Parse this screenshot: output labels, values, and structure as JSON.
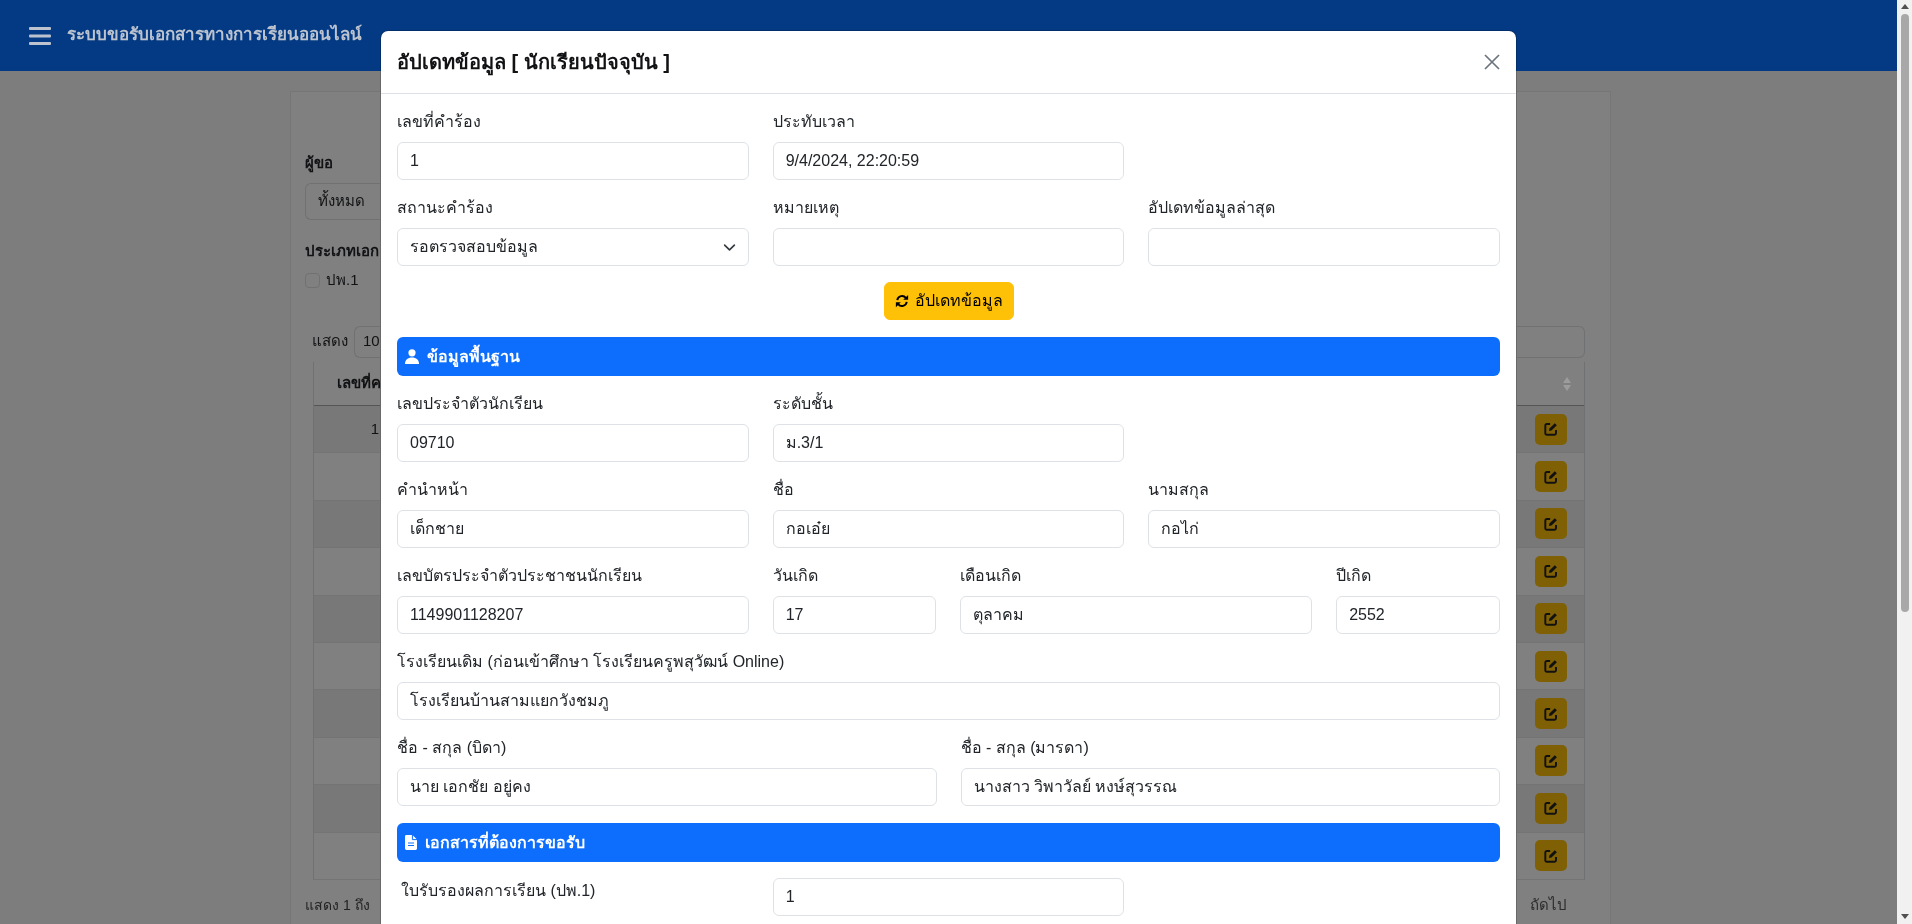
{
  "header": {
    "title": "ระบบขอรับเอกสารทางการเรียนออนไลน์"
  },
  "background": {
    "filter": {
      "requester_label": "ผู้ขอ",
      "requester_value": "ทั้งหมด",
      "doc_type_label": "ประเภทเอก",
      "doc_types": [
        {
          "label": "ปพ.1",
          "checked": false
        }
      ]
    },
    "table": {
      "length_label": "แสดง",
      "length_value": "10",
      "columns": [
        "เลขที่ค"
      ],
      "rows": [
        {
          "kind": "edit",
          "column_1": "1"
        },
        {
          "kind": "edit"
        },
        {
          "kind": "edit"
        },
        {
          "kind": "edit"
        },
        {
          "kind": "edit"
        },
        {
          "kind": "edit"
        },
        {
          "kind": "edit"
        },
        {
          "kind": "edit"
        },
        {
          "kind": "edit"
        },
        {
          "kind": "edit"
        }
      ],
      "info": "แสดง 1 ถึง",
      "next": "ถัดไป"
    }
  },
  "modal": {
    "title": "อัปเดทข้อมูล [ นักเรียนปัจจุบัน ]",
    "request_rows": [
      {
        "fields": [
          {
            "kind": "input",
            "label": "เลขที่คำร้อง",
            "value": "1"
          },
          {
            "kind": "input",
            "label": "ประทับเวลา",
            "value": "9/4/2024, 22:20:59"
          }
        ]
      },
      {
        "fields": [
          {
            "kind": "select",
            "label": "สถานะคำร้อง",
            "value": "รอตรวจสอบข้อมูล"
          },
          {
            "kind": "input",
            "label": "หมายเหตุ"
          },
          {
            "kind": "input",
            "label": "อัปเดทข้อมูลล่าสุด"
          }
        ]
      }
    ],
    "update_button": "อัปเดทข้อมูล",
    "sections": [
      {
        "kind": "person",
        "title": "ข้อมูลพื้นฐาน",
        "rows": [
          {
            "fields": [
              {
                "kind": "input",
                "label": "เลขประจำตัวนักเรียน",
                "value": "09710"
              },
              {
                "kind": "input",
                "label": "ระดับชั้น",
                "value": "ม.3/1"
              }
            ]
          },
          {
            "fields": [
              {
                "kind": "input",
                "label": "คำนำหน้า",
                "value": "เด็กชาย"
              },
              {
                "kind": "input",
                "label": "ชื่อ",
                "value": "กอเอ๋ย"
              },
              {
                "kind": "input",
                "label": "นามสกุล",
                "value": "กอไก่"
              }
            ]
          },
          {
            "fields": [
              {
                "kind": "input",
                "label": "เลขบัตรประจำตัวประชาชนนักเรียน",
                "value": "1149901128207"
              },
              {
                "kind": "input",
                "label": "วันเกิด",
                "value": "17"
              },
              {
                "kind": "input",
                "label": "เดือนเกิด",
                "value": "ตุลาคม"
              },
              {
                "kind": "input",
                "label": "ปีเกิด",
                "value": "2552"
              }
            ]
          },
          {
            "fields": [
              {
                "kind": "input",
                "label": "โรงเรียนเดิม (ก่อนเข้าศึกษา โรงเรียนครูพสุวัฒน์ Online)",
                "value": "โรงเรียนบ้านสามแยกวังชมภู"
              }
            ]
          },
          {
            "fields": [
              {
                "kind": "input",
                "label": "ชื่อ - สกุล (บิดา)",
                "value": "นาย เอกชัย อยู่คง"
              },
              {
                "kind": "input",
                "label": "ชื่อ - สกุล (มารดา)",
                "value": "นางสาว วิพาวัลย์ หงษ์สุวรรณ"
              }
            ]
          }
        ]
      },
      {
        "kind": "document",
        "title": "เอกสารที่ต้องการขอรับ",
        "rows": [
          {
            "fields": [
              {
                "kind": "inline",
                "label": "ใบรับรองผลการเรียน (ปพ.1)",
                "value": "1"
              }
            ]
          }
        ]
      }
    ]
  }
}
